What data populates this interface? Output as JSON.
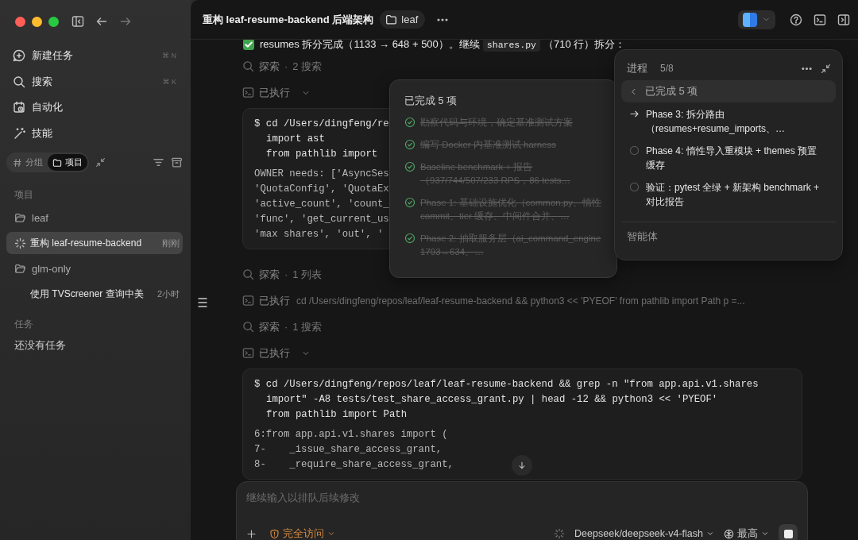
{
  "sidebar": {
    "nav": [
      {
        "label": "新建任务",
        "shortcut": "⌘ N"
      },
      {
        "label": "搜索",
        "shortcut": "⌘ K"
      },
      {
        "label": "自动化"
      },
      {
        "label": "技能"
      }
    ],
    "view_toggle": [
      {
        "label": "分组",
        "selected": false
      },
      {
        "label": "项目",
        "selected": true
      }
    ],
    "sections": [
      {
        "title": "项目",
        "items": [
          {
            "kind": "folder",
            "label": "leaf",
            "children": [
              {
                "kind": "task",
                "label": "重构 leaf-resume-backend",
                "time": "刚刚",
                "selected": true,
                "running": true
              }
            ]
          },
          {
            "kind": "folder",
            "label": "glm-only",
            "children": [
              {
                "kind": "task",
                "label": "使用 TVScreener 查询中美",
                "time": "2小时",
                "selected": false,
                "running": false
              }
            ]
          }
        ]
      },
      {
        "title": "任务",
        "empty_text": "还没有任务"
      }
    ]
  },
  "header": {
    "title": "重构 leaf-resume-backend 后端架构",
    "project": "leaf"
  },
  "conversation": [
    {
      "kind": "message",
      "segments": [
        {
          "kind": "text",
          "text": "resumes 拆分完成（1133 → 648 + 500）。继续"
        },
        {
          "kind": "code",
          "text": "shares.py"
        },
        {
          "kind": "text",
          "text": "（710 行）拆分："
        }
      ]
    },
    {
      "kind": "explore",
      "label": "探索",
      "separator": "·",
      "detail": "2 搜索"
    },
    {
      "kind": "exec",
      "label": "已执行",
      "expanded": true
    },
    {
      "kind": "code",
      "command": [
        "$ cd /Users/dingfeng/re",
        "import ast",
        "from pathlib import"
      ],
      "output": [
        "OWNER needs: ['AsyncSes",
        "'QuotaConfig', 'QuotaEx",
        "'active_count', 'count_",
        "'func', 'get_current_us",
        "'max shares', 'out', '"
      ]
    },
    {
      "kind": "explore",
      "label": "探索",
      "separator": "·",
      "detail": "1 列表"
    },
    {
      "kind": "exec",
      "label": "已执行",
      "expanded": false,
      "command": "cd /Users/dingfeng/repos/leaf/leaf-resume-backend && python3 << 'PYEOF' from pathlib import Path p =..."
    },
    {
      "kind": "explore",
      "label": "探索",
      "separator": "·",
      "detail": "1 搜索"
    },
    {
      "kind": "exec",
      "label": "已执行",
      "expanded": true
    },
    {
      "kind": "code",
      "command": [
        "$ cd /Users/dingfeng/repos/leaf/leaf-resume-backend && grep -n \"from app.api.v1.shares",
        "import\" -A8 tests/test_share_access_grant.py | head -12 && python3 << 'PYEOF'",
        "from pathlib import Path"
      ],
      "output": [
        "6:from app.api.v1.shares import (",
        "7-    _issue_share_access_grant,",
        "8-    _require_share_access_grant,"
      ]
    }
  ],
  "completed_popup": {
    "title": "已完成 5 项",
    "items": [
      {
        "text": "勘察代码与环境，确定基准测试方案",
        "done": true
      },
      {
        "text": "编写 Docker 内基准测试 harness",
        "done": true
      },
      {
        "text": "Baseline benchmark + 报告（937/744/507/233 RPS，86 tests…",
        "done": true
      },
      {
        "text": "Phase 1: 基础设施优化（common.py、惰性 commit、tier 缓存、中间件合并、…",
        "done": true
      },
      {
        "text": "Phase 2: 抽取服务层（ai_command_engine 1793→634、…",
        "done": true
      }
    ]
  },
  "progress_panel": {
    "title": "进程",
    "count": "5/8",
    "completed_summary": {
      "label": "已完成 5 项",
      "selected": true
    },
    "items": [
      {
        "current": true,
        "text": "Phase 3: 拆分路由（resumes+resume_imports、…"
      },
      {
        "current": false,
        "text": "Phase 4: 惰性导入重模块 + themes 预置缓存"
      },
      {
        "current": false,
        "text": "验证：pytest 全绿 + 新架构 benchmark + 对比报告"
      }
    ],
    "footer": "智能体"
  },
  "composer": {
    "placeholder": "继续输入以排队后续修改",
    "access": "完全访问",
    "model": "Deepseek/deepseek-v4-flash",
    "effort": "最高"
  }
}
